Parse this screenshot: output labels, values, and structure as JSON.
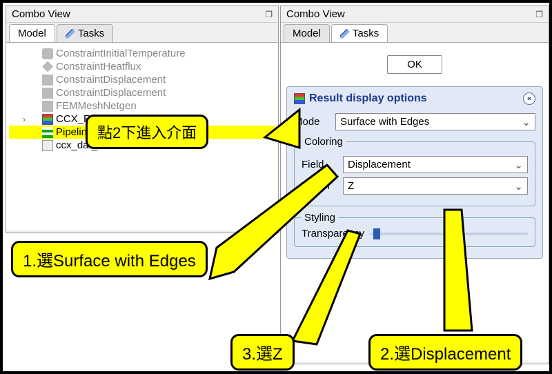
{
  "leftPanel": {
    "title": "Combo View",
    "tabs": {
      "model": "Model",
      "tasks": "Tasks"
    },
    "tree": {
      "items": [
        {
          "label": "ConstraintInitialTemperature"
        },
        {
          "label": "ConstraintHeatflux"
        },
        {
          "label": "ConstraintDisplacement"
        },
        {
          "label": "ConstraintDisplacement"
        },
        {
          "label": "FEMMeshNetgen"
        },
        {
          "label": "CCX_Results"
        },
        {
          "label": "Pipeline_CCX_Results"
        },
        {
          "label": "ccx_dat_file"
        }
      ]
    }
  },
  "rightPanel": {
    "title": "Combo View",
    "tabs": {
      "model": "Model",
      "tasks": "Tasks"
    },
    "okLabel": "OK",
    "taskTitle": "Result display options",
    "modeLabel": "Mode",
    "modeValue": "Surface with Edges",
    "coloringLegend": "Coloring",
    "fieldLabel": "Field",
    "fieldValue": "Displacement",
    "vectorLabel": "Vector",
    "vectorValue": "Z",
    "stylingLegend": "Styling",
    "transparencyLabel": "Transparency"
  },
  "callouts": {
    "dblclick": "點2下進入介面",
    "step1": "1.選Surface with Edges",
    "step2": "2.選Displacement",
    "step3": "3.選Z"
  }
}
